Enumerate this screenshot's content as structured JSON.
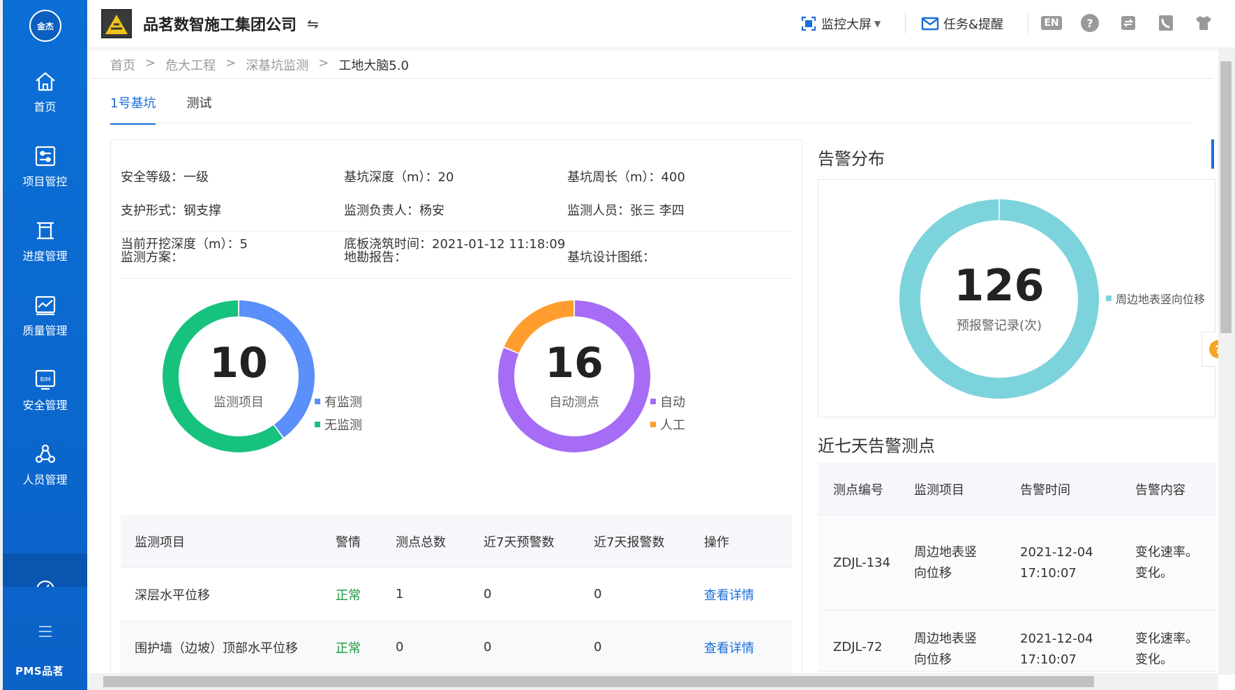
{
  "sidebar": {
    "logo_text": "金杰",
    "items": [
      {
        "label": "首页",
        "icon": "home-icon"
      },
      {
        "label": "项目管控",
        "icon": "sliders-icon"
      },
      {
        "label": "进度管理",
        "icon": "progress-icon"
      },
      {
        "label": "质量管理",
        "icon": "quality-icon"
      },
      {
        "label": "安全管理",
        "icon": "bim-icon"
      },
      {
        "label": "人员管理",
        "icon": "people-icon"
      }
    ],
    "brand": "PMS品茗"
  },
  "topbar": {
    "company": "品茗数智施工集团公司",
    "monitor_label": "监控大屏",
    "task_label": "任务&提醒",
    "lang": "EN"
  },
  "breadcrumb": [
    "首页",
    "危大工程",
    "深基坑监测",
    "工地大脑5.0"
  ],
  "tabs": [
    "1号基坑",
    "测试"
  ],
  "info": {
    "safety_level": "安全等级：一级",
    "depth": "基坑深度（m）：20",
    "perimeter": "基坑周长（m）：400",
    "support": "支护形式：钢支撑",
    "owner": "监测负责人：杨安",
    "staff": "监测人员：张三 李四",
    "current_depth": "当前开挖深度（m）：5",
    "pour_time": "底板浇筑时间：2021-01-12 11:18:09",
    "plan": "监测方案：",
    "survey": "地勘报告：",
    "drawing": "基坑设计图纸："
  },
  "chart_data": [
    {
      "type": "pie",
      "title": "监测项目",
      "total": "10",
      "categories": [
        "有监测",
        "无监测"
      ],
      "values": [
        4,
        6
      ],
      "colors": [
        "#5b8ff9",
        "#17c27e"
      ]
    },
    {
      "type": "pie",
      "title": "自动测点",
      "total": "16",
      "categories": [
        "自动",
        "人工"
      ],
      "values": [
        13,
        3
      ],
      "colors": [
        "#a66cf6",
        "#ff9d2e"
      ]
    },
    {
      "type": "pie",
      "title": "预报警记录(次)",
      "total": "126",
      "categories": [
        "周边地表竖向位移"
      ],
      "values": [
        126
      ],
      "colors": [
        "#7dd3dc"
      ]
    }
  ],
  "left_table": {
    "headers": [
      "监测项目",
      "警情",
      "测点总数",
      "近7天预警数",
      "近7天报警数",
      "操作"
    ],
    "rows": [
      [
        "深层水平位移",
        "正常",
        "1",
        "0",
        "0",
        "查看详情"
      ],
      [
        "围护墙（边坡）顶部水平位移",
        "正常",
        "0",
        "0",
        "0",
        "查看详情"
      ]
    ]
  },
  "right": {
    "alarm_title": "告警分布",
    "recent_title": "近七天告警测点",
    "table_headers": [
      "测点编号",
      "监测项目",
      "告警时间",
      "告警内容"
    ],
    "rows": [
      {
        "id": "ZDJL-134",
        "item_l1": "周边地表竖",
        "item_l2": "向位移",
        "date": "2021-12-04",
        "time": "17:10:07",
        "content_l1": "变化速率。",
        "content_l2": "变化。"
      },
      {
        "id": "ZDJL-72",
        "item_l1": "周边地表竖",
        "item_l2": "向位移",
        "date": "2021-12-04",
        "time": "17:10:07",
        "content_l1": "变化速率。",
        "content_l2": "变化。"
      }
    ]
  }
}
